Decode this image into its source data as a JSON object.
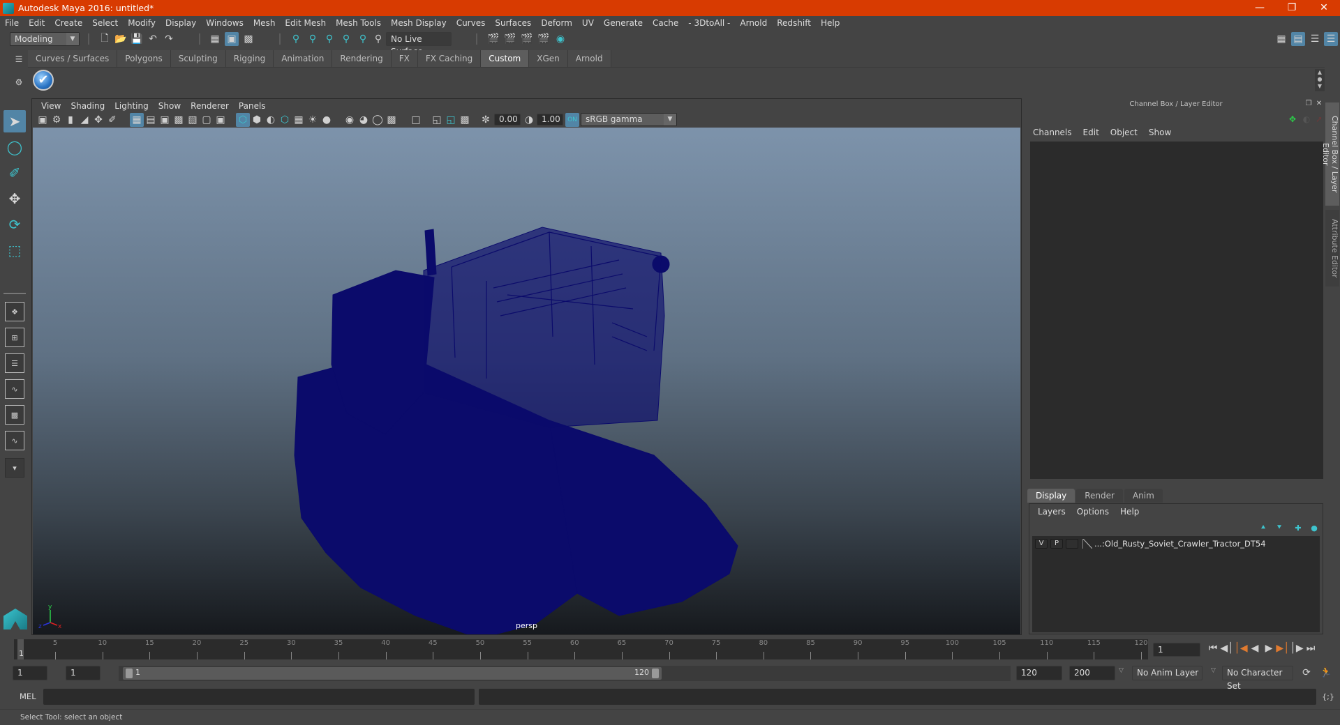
{
  "window": {
    "title": "Autodesk Maya 2016: untitled*",
    "controls": [
      "minimize-icon",
      "restore-icon",
      "close-icon"
    ]
  },
  "menubar": [
    "File",
    "Edit",
    "Create",
    "Select",
    "Modify",
    "Display",
    "Windows",
    "Mesh",
    "Edit Mesh",
    "Mesh Tools",
    "Mesh Display",
    "Curves",
    "Surfaces",
    "Deform",
    "UV",
    "Generate",
    "Cache",
    "- 3DtoAll -",
    "Arnold",
    "Redshift",
    "Help"
  ],
  "statusline": {
    "menuset": "Modeling",
    "live_surface": "No Live Surface"
  },
  "shelf": {
    "tabs": [
      "Curves / Surfaces",
      "Polygons",
      "Sculpting",
      "Rigging",
      "Animation",
      "Rendering",
      "FX",
      "FX Caching",
      "Custom",
      "XGen",
      "Arnold"
    ],
    "active_tab": "Custom"
  },
  "viewport": {
    "menu": [
      "View",
      "Shading",
      "Lighting",
      "Show",
      "Renderer",
      "Panels"
    ],
    "exposure": "0.00",
    "gamma": "1.00",
    "color_space": "sRGB gamma",
    "camera": "persp",
    "wire_color": "#0b0b6b"
  },
  "channel_box": {
    "title": "Channel Box / Layer Editor",
    "menu": [
      "Channels",
      "Edit",
      "Object",
      "Show"
    ]
  },
  "layer_editor": {
    "tabs": [
      "Display",
      "Render",
      "Anim"
    ],
    "active_tab": "Display",
    "menu": [
      "Layers",
      "Options",
      "Help"
    ],
    "layers": [
      {
        "v": "V",
        "p": "P",
        "name": "...:Old_Rusty_Soviet_Crawler_Tractor_DT54"
      }
    ]
  },
  "side_tabs": [
    "Channel Box / Layer Editor",
    "Attribute Editor"
  ],
  "timeline": {
    "ticks": [
      "5",
      "10",
      "15",
      "20",
      "25",
      "30",
      "35",
      "40",
      "45",
      "50",
      "55",
      "60",
      "65",
      "70",
      "75",
      "80",
      "85",
      "90",
      "95",
      "100",
      "105",
      "110",
      "115",
      "120"
    ],
    "current_frame_marker": "1",
    "current_frame": "1",
    "start": 1,
    "end": 120
  },
  "range": {
    "start_time": "1",
    "playback_start": "1",
    "range_start_label": "1",
    "range_end_label": "120",
    "playback_end": "120",
    "end_time": "200",
    "anim_layer": "No Anim Layer",
    "character_set": "No Character Set"
  },
  "command_line": {
    "label": "MEL",
    "value": ""
  },
  "help_line": "Select Tool: select an object",
  "colors": {
    "title_bar": "#d83b01",
    "accent": "#5285a6",
    "teal": "#3ec4ce",
    "playback_key": "#e07a2f"
  }
}
